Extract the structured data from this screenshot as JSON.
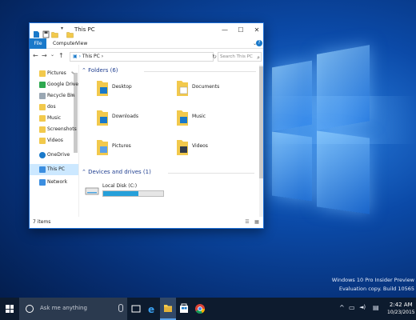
{
  "window": {
    "title": "This PC",
    "controls": {
      "minimize": "—",
      "maximize": "☐",
      "close": "✕"
    }
  },
  "ribbon": {
    "tabs": [
      "File",
      "Computer",
      "View"
    ],
    "toggle": "⌄",
    "help": "?"
  },
  "navbar": {
    "back": "←",
    "forward": "→",
    "recent": "⌄",
    "up": "↑",
    "address": "This PC",
    "refresh": "↻",
    "search_placeholder": "Search This PC"
  },
  "sidebar": {
    "items": [
      {
        "label": "Pictures",
        "icon": "pictures-folder-icon",
        "pinned": true
      },
      {
        "label": "Google Drive",
        "icon": "google-drive-icon",
        "pinned": true
      },
      {
        "label": "Recycle Bin",
        "icon": "recycle-bin-icon",
        "pinned": true
      },
      {
        "label": "dos",
        "icon": "folder-icon",
        "pinned": false
      },
      {
        "label": "Music",
        "icon": "music-folder-icon",
        "pinned": false
      },
      {
        "label": "Screenshots",
        "icon": "folder-icon",
        "pinned": false
      },
      {
        "label": "Videos",
        "icon": "videos-folder-icon",
        "pinned": false
      },
      {
        "label": "OneDrive",
        "icon": "onedrive-icon",
        "pinned": false
      },
      {
        "label": "This PC",
        "icon": "computer-icon",
        "pinned": false,
        "selected": true
      },
      {
        "label": "Network",
        "icon": "network-icon",
        "pinned": false
      }
    ],
    "pin_glyph": "📌"
  },
  "content": {
    "folders_header": "Folders (6)",
    "folders": [
      {
        "label": "Desktop",
        "icon": "desktop-folder-icon"
      },
      {
        "label": "Documents",
        "icon": "documents-folder-icon"
      },
      {
        "label": "Downloads",
        "icon": "downloads-folder-icon"
      },
      {
        "label": "Music",
        "icon": "music-folder-icon"
      },
      {
        "label": "Pictures",
        "icon": "pictures-folder-icon"
      },
      {
        "label": "Videos",
        "icon": "videos-folder-icon"
      }
    ],
    "drives_header": "Devices and drives (1)",
    "drive": {
      "label": "Local Disk (C:)",
      "used_fraction": 0.58
    }
  },
  "status": {
    "text": "7 items"
  },
  "watermark": {
    "line1": "Windows 10 Pro Insider Preview",
    "line2": "Evaluation copy. Build 10565"
  },
  "taskbar": {
    "search_placeholder": "Ask me anything",
    "apps": [
      "task-view-icon",
      "edge-icon",
      "file-explorer-icon",
      "store-icon",
      "chrome-icon"
    ],
    "tray": {
      "chevron": "^",
      "network": "▭",
      "volume": "◄)",
      "notifications": "▤"
    },
    "time": "2:42 AM",
    "date": "10/23/2015"
  },
  "colors": {
    "accent": "#1979ca",
    "taskbar": "#0d1b2e",
    "folder_yellow": "#f2c94c",
    "drive_fill": "#26a0da"
  }
}
